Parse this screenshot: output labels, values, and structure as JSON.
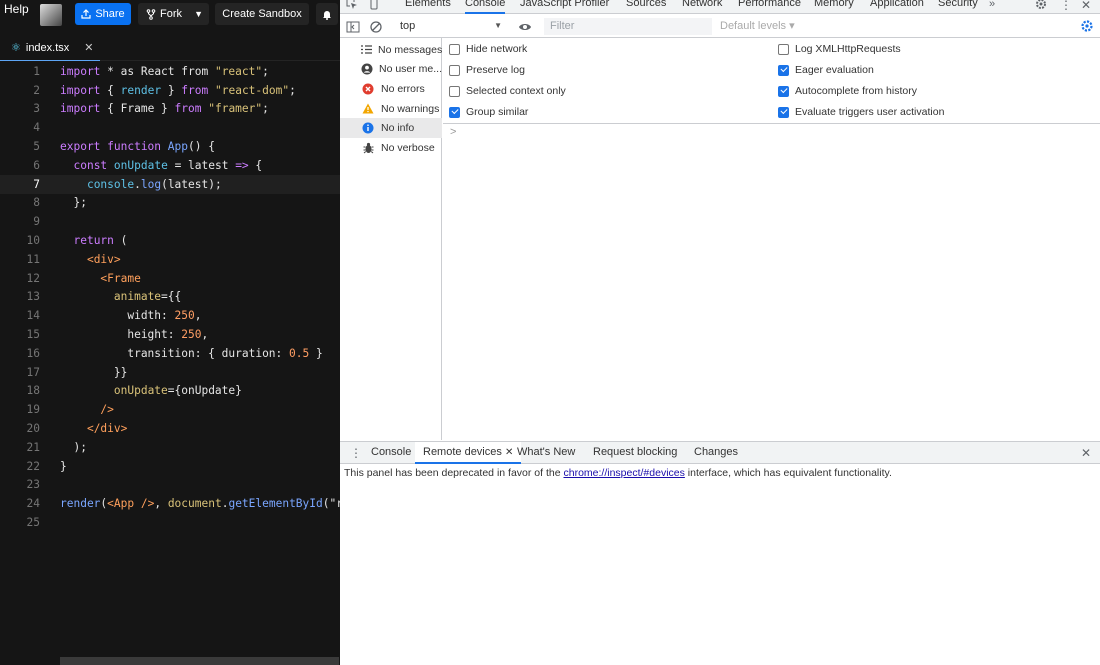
{
  "header": {
    "help_label": "Help",
    "share_label": "Share",
    "fork_label": "Fork",
    "create_sandbox_label": "Create Sandbox"
  },
  "editor": {
    "tab_label": "index.tsx",
    "current_line": 7
  },
  "devtools": {
    "tabs": [
      "Elements",
      "Console",
      "JavaScript Profiler",
      "Sources",
      "Network",
      "Performance",
      "Memory",
      "Application",
      "Security"
    ],
    "active_tab": "Console",
    "context": "top",
    "filter_placeholder": "Filter",
    "levels_label": "Default levels",
    "sidebar_items": [
      {
        "label": "No messages",
        "icon": "list-icon"
      },
      {
        "label": "No user me...",
        "icon": "user-icon"
      },
      {
        "label": "No errors",
        "icon": "error-icon"
      },
      {
        "label": "No warnings",
        "icon": "warning-icon"
      },
      {
        "label": "No info",
        "icon": "info-icon"
      },
      {
        "label": "No verbose",
        "icon": "bug-icon"
      }
    ],
    "settings_left": [
      {
        "label": "Hide network",
        "checked": false
      },
      {
        "label": "Preserve log",
        "checked": false
      },
      {
        "label": "Selected context only",
        "checked": false
      },
      {
        "label": "Group similar",
        "checked": true
      }
    ],
    "settings_right": [
      {
        "label": "Log XMLHttpRequests",
        "checked": false
      },
      {
        "label": "Eager evaluation",
        "checked": true
      },
      {
        "label": "Autocomplete from history",
        "checked": true
      },
      {
        "label": "Evaluate triggers user activation",
        "checked": true
      }
    ],
    "prompt": ">",
    "drawer_tabs": [
      "Console",
      "Remote devices",
      "What's New",
      "Request blocking",
      "Changes"
    ],
    "drawer_active": "Remote devices",
    "drawer_msg_before": "This panel has been deprecated in favor of the ",
    "drawer_link": "chrome://inspect/#devices",
    "drawer_msg_after": " interface, which has equivalent functionality."
  },
  "colors": {
    "accent": "#1a73e8",
    "share_button": "#0971f1",
    "editor_bg": "#151515"
  }
}
